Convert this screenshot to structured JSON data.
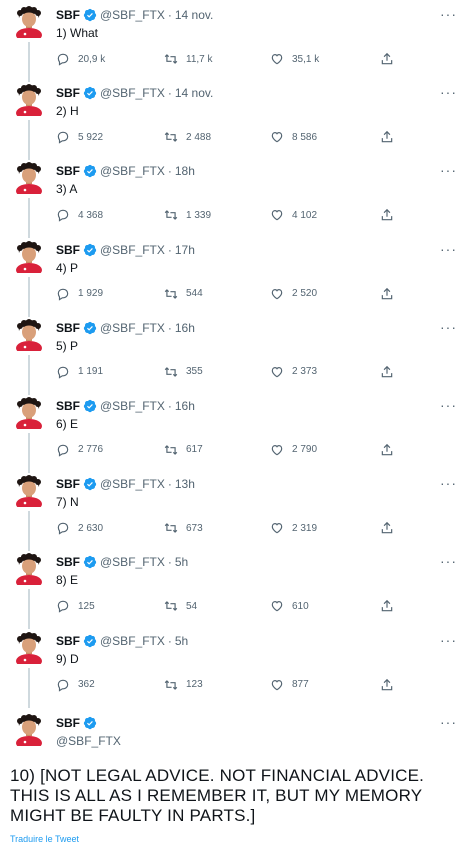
{
  "colors": {
    "verified": "#1d9bf0",
    "link": "#1d9bf0",
    "muted": "#536471",
    "thread_line": "#cfd9de"
  },
  "icons": {
    "reply": "reply-icon",
    "retweet": "retweet-icon",
    "like": "heart-icon",
    "share": "share-icon",
    "more": "more-icon",
    "verified": "verified-badge-icon"
  },
  "tweets": [
    {
      "name": "SBF",
      "handle": "@SBF_FTX",
      "dot": "·",
      "time": "14 nov.",
      "text": "1) What",
      "replies": "20,9 k",
      "retweets": "11,7 k",
      "likes": "35,1 k"
    },
    {
      "name": "SBF",
      "handle": "@SBF_FTX",
      "dot": "·",
      "time": "14 nov.",
      "text": "2) H",
      "replies": "5 922",
      "retweets": "2 488",
      "likes": "8 586"
    },
    {
      "name": "SBF",
      "handle": "@SBF_FTX",
      "dot": "·",
      "time": "18h",
      "text": "3) A",
      "replies": "4 368",
      "retweets": "1 339",
      "likes": "4 102"
    },
    {
      "name": "SBF",
      "handle": "@SBF_FTX",
      "dot": "·",
      "time": "17h",
      "text": "4) P",
      "replies": "1 929",
      "retweets": "544",
      "likes": "2 520"
    },
    {
      "name": "SBF",
      "handle": "@SBF_FTX",
      "dot": "·",
      "time": "16h",
      "text": "5) P",
      "replies": "1 191",
      "retweets": "355",
      "likes": "2 373"
    },
    {
      "name": "SBF",
      "handle": "@SBF_FTX",
      "dot": "·",
      "time": "16h",
      "text": "6) E",
      "replies": "2 776",
      "retweets": "617",
      "likes": "2 790"
    },
    {
      "name": "SBF",
      "handle": "@SBF_FTX",
      "dot": "·",
      "time": "13h",
      "text": "7) N",
      "replies": "2 630",
      "retweets": "673",
      "likes": "2 319"
    },
    {
      "name": "SBF",
      "handle": "@SBF_FTX",
      "dot": "·",
      "time": "5h",
      "text": "8) E",
      "replies": "125",
      "retweets": "54",
      "likes": "610"
    },
    {
      "name": "SBF",
      "handle": "@SBF_FTX",
      "dot": "·",
      "time": "5h",
      "text": "9) D",
      "replies": "362",
      "retweets": "123",
      "likes": "877"
    }
  ],
  "final_tweet": {
    "name": "SBF",
    "handle": "@SBF_FTX",
    "text": "10) [NOT LEGAL ADVICE.  NOT FINANCIAL ADVICE.  THIS IS ALL AS I REMEMBER IT, BUT MY MEMORY MIGHT BE FAULTY IN PARTS.]",
    "translate": "Traduire le Tweet"
  }
}
